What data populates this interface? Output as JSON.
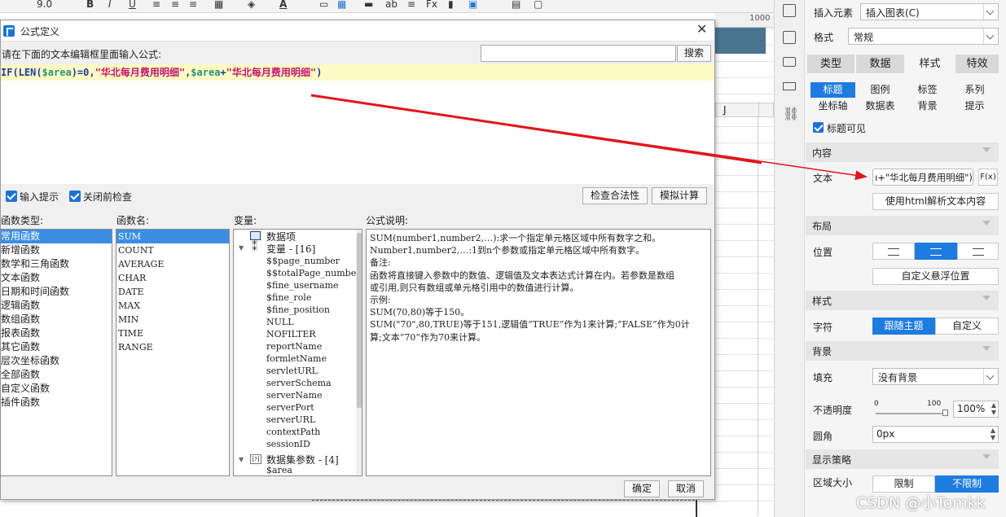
{
  "toolbar": {
    "font_size": "9.0",
    "bold": "B",
    "italic": "I",
    "underline": "U",
    "font_color": "A",
    "ab": "ab",
    "fx": "Fx"
  },
  "sheet": {
    "col_j": "J",
    "ruler_value": "1000"
  },
  "dialog": {
    "title": "公式定义",
    "prompt": "请在下面的文本编辑框里面输入公式:",
    "search_placeholder": "",
    "search_button": "搜索",
    "formula": {
      "p1": "IF(LEN(",
      "v1": "$area",
      "p2": ")=0,",
      "s1": "\"华北每月费用明细\"",
      "p3": ",",
      "v2": "$area",
      "p4": "+",
      "s2": "\"华北每月费用明细\"",
      "p5": ")"
    },
    "input_hint_label": "输入提示",
    "check_on_close_label": "关闭前检查",
    "validate_button": "检查合法性",
    "simulate_button": "模拟计算",
    "function_types_label": "函数类型:",
    "function_names_label": "函数名:",
    "variables_label": "变量:",
    "description_label": "公式说明:",
    "function_types": [
      "常用函数",
      "新增函数",
      "数学和三角函数",
      "文本函数",
      "日期和时间函数",
      "逻辑函数",
      "数组函数",
      "报表函数",
      "其它函数",
      "层次坐标函数",
      "全部函数",
      "自定义函数",
      "插件函数"
    ],
    "function_names": [
      "SUM",
      "COUNT",
      "AVERAGE",
      "CHAR",
      "DATE",
      "MAX",
      "MIN",
      "TIME",
      "RANGE"
    ],
    "variables_tree": {
      "data_item": "数据项",
      "variables_group": "变量 - [16]",
      "variables": [
        "$$page_number",
        "$$totalPage_number",
        "$fine_username",
        "$fine_role",
        "$fine_position",
        "NULL",
        "NOFILTER",
        "reportName",
        "formletName",
        "servletURL",
        "serverSchema",
        "serverName",
        "serverPort",
        "serverURL",
        "contextPath",
        "sessionID"
      ],
      "dataset_params_group": "数据集参数 - [4]",
      "dataset_params": [
        "$area"
      ]
    },
    "description_lines": [
      "SUM(number1,number2,…):求一个指定单元格区域中所有数字之和。",
      "Number1,number2,…:1到n个参数或指定单元格区域中所有数字。",
      "备注:",
      "函数将直接键入参数中的数值、逻辑值及文本表达式计算在内。若参数是数组",
      "或引用,则只有数组或单元格引用中的数值进行计算。",
      "示例:",
      "SUM(70,80)等于150。",
      "SUM(\"70\",80,TRUE)等于151,逻辑值“TRUE”作为1来计算;“FALSE”作为0计",
      "算;文本“70”作为70来计算。"
    ],
    "ok_button": "确定",
    "cancel_button": "取消"
  },
  "panel": {
    "insert_element_label": "插入元素",
    "insert_element_value": "插入图表(C)",
    "format_label": "格式",
    "format_value": "常规",
    "tabs": [
      "类型",
      "数据",
      "样式",
      "特效"
    ],
    "subtabs": [
      "标题",
      "图例",
      "标签",
      "系列",
      "坐标轴",
      "数据表",
      "背景",
      "提示"
    ],
    "title_visible_label": "标题可见",
    "content_section": "内容",
    "text_label": "文本",
    "text_value": "ı+\"华北每月费用明细\")",
    "fx_label": "F(x)",
    "html_button": "使用html解析文本内容",
    "layout_section": "布局",
    "position_label": "位置",
    "custom_float_button": "自定义悬浮位置",
    "style_section": "样式",
    "font_label": "字符",
    "follow_theme_button": "跟随主题",
    "custom_button": "自定义",
    "background_section": "背景",
    "fill_label": "填充",
    "fill_value": "没有背景",
    "opacity_label": "不透明度",
    "slider_min": "0",
    "slider_max": "100",
    "opacity_value": "100%",
    "radius_label": "圆角",
    "radius_value": "0px",
    "display_strategy_section": "显示策略",
    "area_size_label": "区域大小",
    "limit_button": "限制",
    "unlimited_button": "不限制"
  },
  "watermark": "CSDN @小Tomkk",
  "colors": {
    "accent": "#1e7ce0",
    "formula_bg": "#fdfbc4",
    "variable": "#2d8f7b",
    "string": "#c4156f",
    "arrow": "#e0161e"
  }
}
